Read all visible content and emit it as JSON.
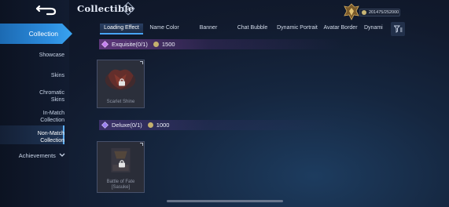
{
  "header": {
    "title": "Collectible",
    "help_label": "?",
    "points": "201475/252000"
  },
  "sidebar": {
    "collection_label": "Collection",
    "items": [
      {
        "label": "Showcase"
      },
      {
        "label": "Skins"
      },
      {
        "label": "Chromatic\nSkins"
      },
      {
        "label": "In-Match\nCollection"
      },
      {
        "label": "Non-Match\nCollection"
      }
    ],
    "achievements_label": "Achievements"
  },
  "tabs": [
    {
      "label": "Loading Effect",
      "active": true
    },
    {
      "label": "Name Color",
      "active": false
    },
    {
      "label": "Banner",
      "active": false
    },
    {
      "label": "Chat Bubble",
      "active": false
    },
    {
      "label": "Dynamic Portrait",
      "active": false
    },
    {
      "label": "Avatar Border",
      "active": false
    },
    {
      "label": "Dynami",
      "active": false
    }
  ],
  "sections": [
    {
      "name": "Exquisite(0/1)",
      "cost": "1500",
      "color": "#b46adf",
      "items": [
        {
          "name": "Scarlet Shine",
          "locked": true
        }
      ]
    },
    {
      "name": "Deluxe(0/1)",
      "cost": "1000",
      "color": "#8c6ee0",
      "items": [
        {
          "name": "Battle of Fate\n[Sasuke]",
          "locked": true
        }
      ]
    }
  ],
  "colors": {
    "accent_blue": "#2d8ee0",
    "coin_gold": "#c4b06e",
    "background": "#15263f"
  },
  "icons": [
    "back-arrow-icon",
    "help-diamond-icon",
    "rank-emblem-icon",
    "coin-icon",
    "filter-sort-icon",
    "gem-icon",
    "lock-icon",
    "chevron-down-icon"
  ]
}
